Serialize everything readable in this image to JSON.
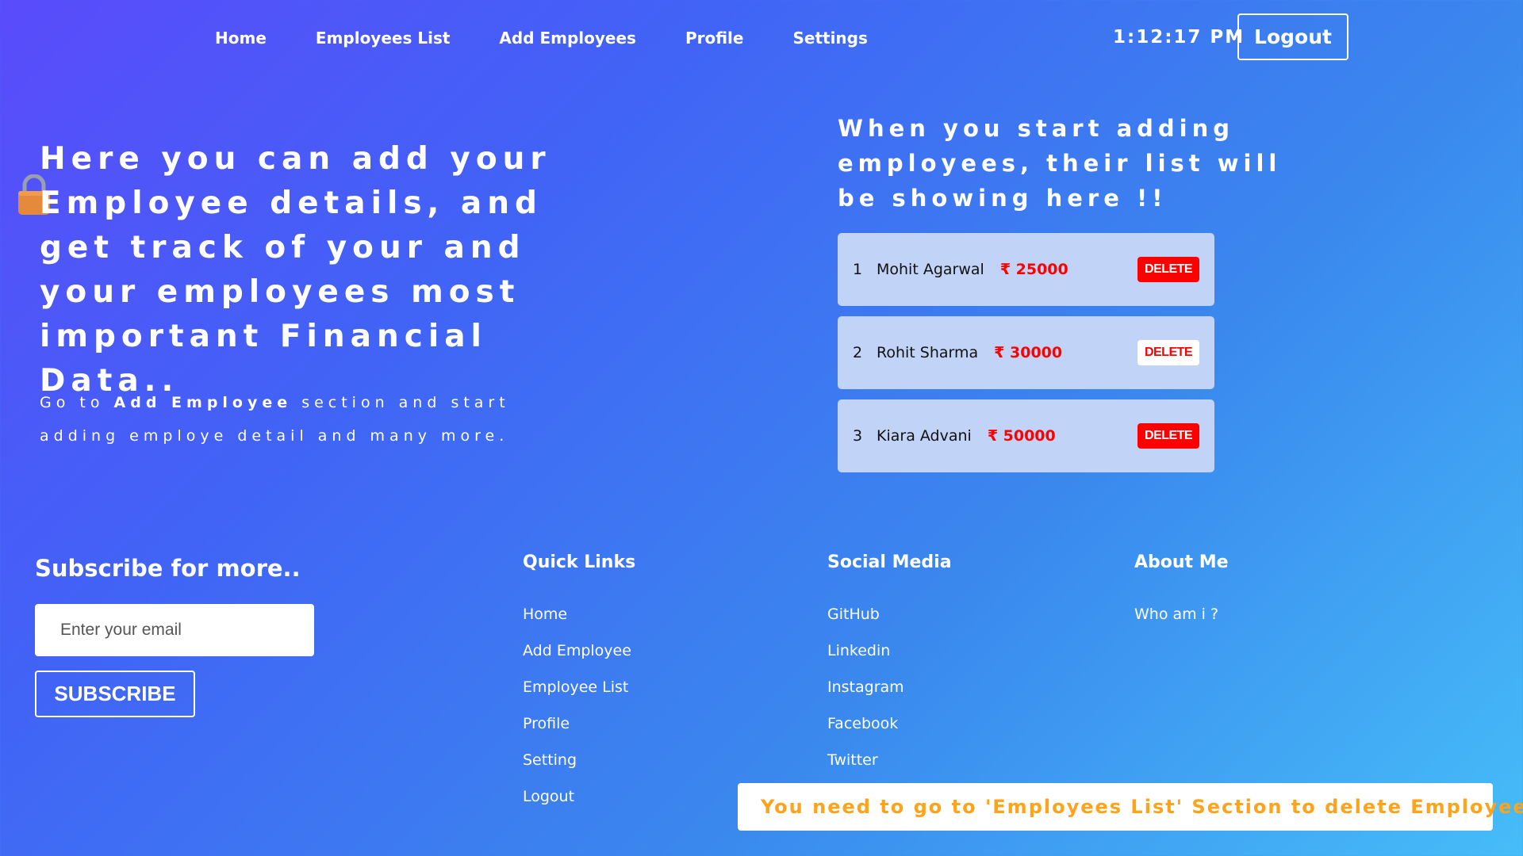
{
  "nav": {
    "links": [
      "Home",
      "Employees List",
      "Add Employees",
      "Profile",
      "Settings"
    ],
    "clock": "1:12:17 PM",
    "logout_label": "Logout"
  },
  "hero": {
    "title": "Here you can add your Employee details, and get track of your and your employees most important Financial Data..",
    "sub_prefix": "Go to",
    "sub_bold": "Add Employee",
    "sub_suffix": "section and start adding employe detail and many more.",
    "lock_icon": "lock-icon"
  },
  "employees": {
    "heading": "When you start adding employees, their list will be showing here !!",
    "rows": [
      {
        "num": "1",
        "name": "Mohit Agarwal",
        "salary": "₹ 25000",
        "delete_label": "DELETE",
        "delete_style": "red"
      },
      {
        "num": "2",
        "name": "Rohit Sharma",
        "salary": "₹ 30000",
        "delete_label": "DELETE",
        "delete_style": "white"
      },
      {
        "num": "3",
        "name": "Kiara Advani",
        "salary": "₹ 50000",
        "delete_label": "DELETE",
        "delete_style": "red"
      }
    ]
  },
  "subscribe": {
    "title": "Subscribe for more..",
    "placeholder": "Enter your email",
    "button_label": "SUBSCRIBE"
  },
  "footer": {
    "quick_links": {
      "title": "Quick Links",
      "links": [
        "Home",
        "Add Employee",
        "Employee List",
        "Profile",
        "Setting",
        "Logout"
      ]
    },
    "social": {
      "title": "Social Media",
      "links": [
        "GitHub",
        "Linkedin",
        "Instagram",
        "Facebook",
        "Twitter"
      ]
    },
    "about": {
      "title": "About Me",
      "links": [
        "Who am i ?"
      ]
    }
  },
  "toast": {
    "message": "You need to go to 'Employees List' Section to delete Employee Data",
    "accent": "#ffa31a"
  },
  "colors": {
    "delete_red": "#ff0000",
    "card_bg": "#c1d3f6"
  }
}
